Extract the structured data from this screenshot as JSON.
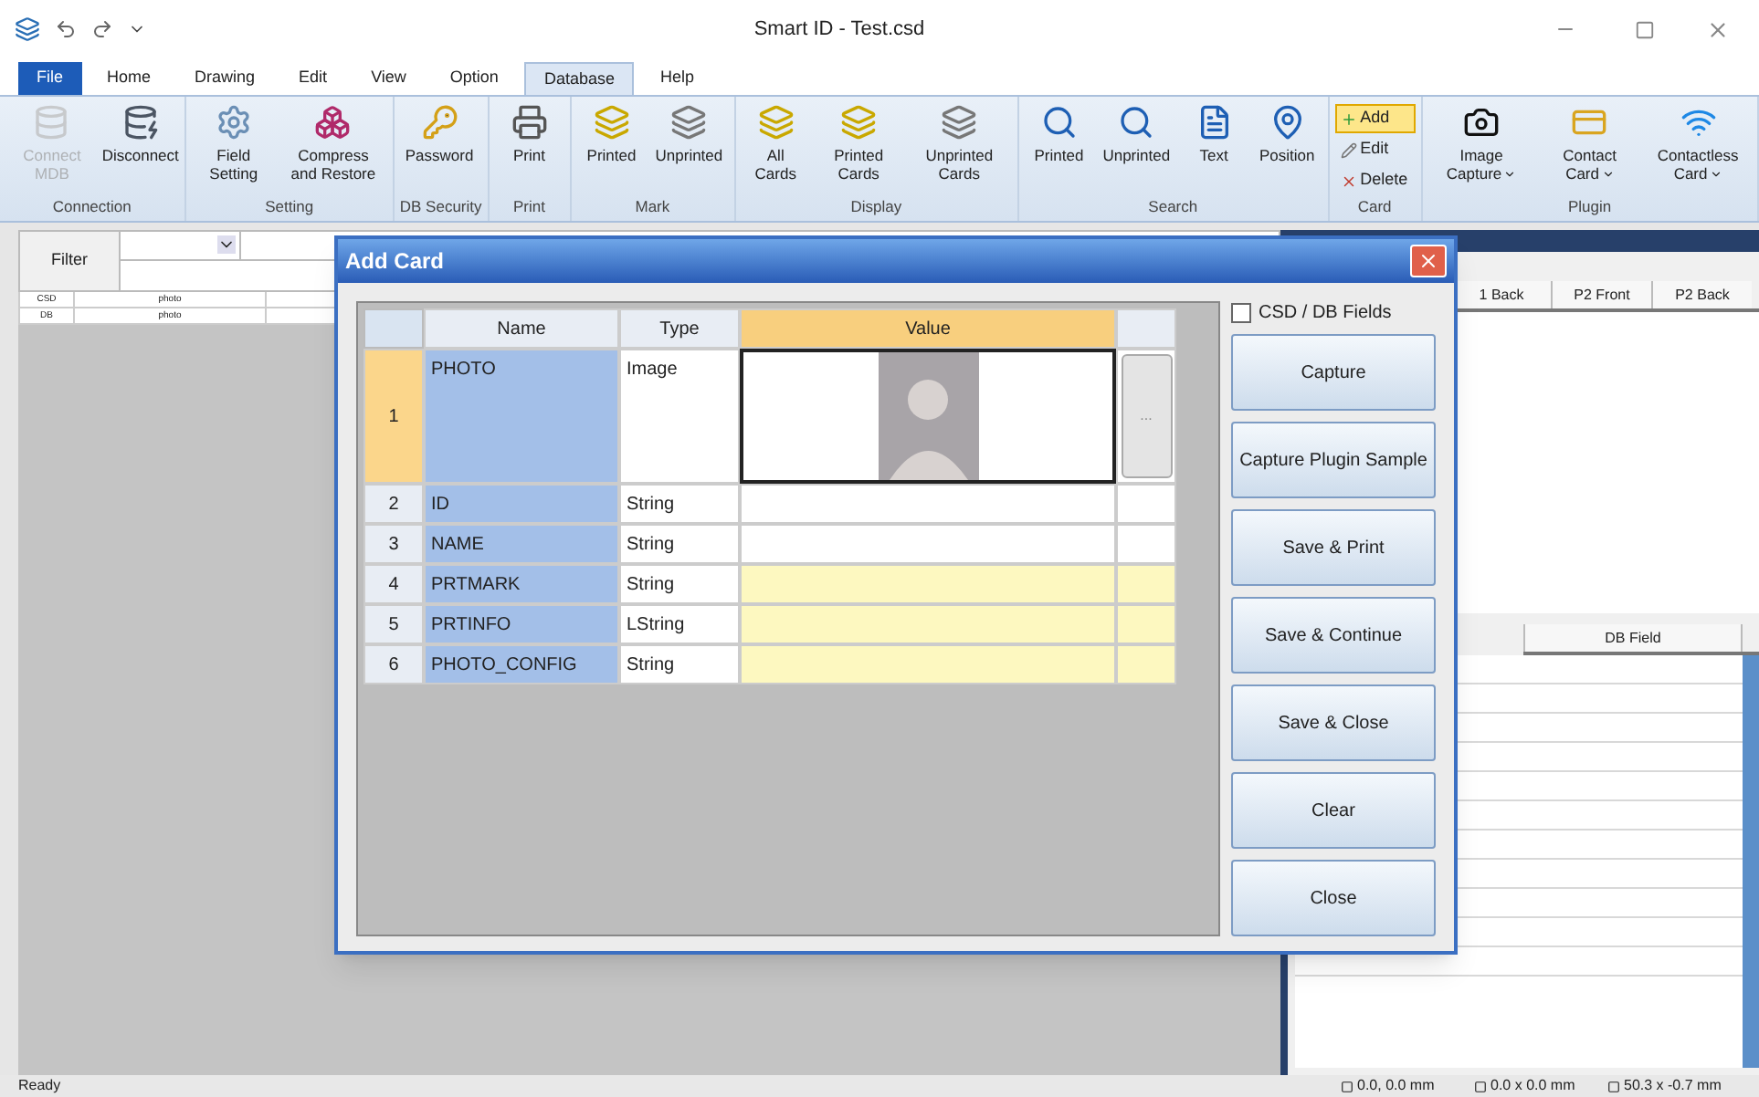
{
  "window": {
    "title": "Smart ID - Test.csd"
  },
  "tabs": [
    {
      "label": "File",
      "selected": false,
      "kind": "file"
    },
    {
      "label": "Home",
      "selected": false,
      "kind": "tab"
    },
    {
      "label": "Drawing",
      "selected": false,
      "kind": "tab"
    },
    {
      "label": "Edit",
      "selected": false,
      "kind": "tab"
    },
    {
      "label": "View",
      "selected": false,
      "kind": "tab"
    },
    {
      "label": "Option",
      "selected": false,
      "kind": "tab"
    },
    {
      "label": "Database",
      "selected": true,
      "kind": "tab"
    },
    {
      "label": "Help",
      "selected": false,
      "kind": "tab"
    }
  ],
  "ribbon": [
    {
      "label": "Connection",
      "items": [
        {
          "label": "Connect MDB",
          "kind": "large",
          "disabled": true
        },
        {
          "label": "Disconnect",
          "kind": "large",
          "disabled": false
        }
      ]
    },
    {
      "label": "Setting",
      "items": [
        {
          "label": "Field Setting",
          "kind": "large",
          "disabled": false
        },
        {
          "label": "Compress and Restore",
          "kind": "large",
          "disabled": false
        }
      ]
    },
    {
      "label": "DB Security",
      "items": [
        {
          "label": "Password",
          "kind": "large",
          "disabled": false
        }
      ]
    },
    {
      "label": "Print",
      "items": [
        {
          "label": "Print",
          "kind": "large",
          "disabled": false
        }
      ]
    },
    {
      "label": "Mark",
      "items": [
        {
          "label": "Printed",
          "kind": "large",
          "disabled": false
        },
        {
          "label": "Unprinted",
          "kind": "large",
          "disabled": false
        }
      ]
    },
    {
      "label": "Display",
      "items": [
        {
          "label": "All Cards",
          "kind": "large",
          "disabled": false
        },
        {
          "label": "Printed Cards",
          "kind": "large",
          "disabled": false
        },
        {
          "label": "Unprinted Cards",
          "kind": "large",
          "disabled": false
        }
      ]
    },
    {
      "label": "Search",
      "items": [
        {
          "label": "Printed",
          "kind": "large",
          "disabled": false
        },
        {
          "label": "Unprinted",
          "kind": "large",
          "disabled": false
        },
        {
          "label": "Text",
          "kind": "large",
          "disabled": false
        },
        {
          "label": "Position",
          "kind": "large",
          "disabled": false
        }
      ]
    },
    {
      "label": "Card",
      "items": [
        {
          "label": "Add",
          "kind": "small",
          "disabled": false,
          "selected": true
        },
        {
          "label": "Edit",
          "kind": "small",
          "disabled": false,
          "selected": false
        },
        {
          "label": "Delete",
          "kind": "small",
          "disabled": false,
          "selected": false
        }
      ]
    },
    {
      "label": "Plugin",
      "items": [
        {
          "label": "Image Capture",
          "kind": "menu",
          "disabled": false
        },
        {
          "label": "Contact Card",
          "kind": "menu",
          "disabled": false
        },
        {
          "label": "Contactless Card",
          "kind": "menu",
          "disabled": false
        }
      ]
    }
  ],
  "filter": {
    "label": "Filter"
  },
  "records": [
    {
      "source": "CSD",
      "field": "photo"
    },
    {
      "source": "DB",
      "field": "photo"
    }
  ],
  "preview_tabs": [
    "1 Back",
    "P2 Front",
    "P2 Back"
  ],
  "field_tabs": [
    "DB Field"
  ],
  "status_bar": {
    "text": "Ready",
    "position": "0.0, 0.0 mm",
    "size": "0.0 x 0.0 mm",
    "cursor": "50.3 x -0.7 mm"
  },
  "dialog": {
    "title": "Add Card",
    "columns": [
      {
        "label": "Name",
        "selected": false
      },
      {
        "label": "Type",
        "selected": false
      },
      {
        "label": "Value",
        "selected": true
      }
    ],
    "rows": [
      {
        "number": "1",
        "name": "PHOTO",
        "type": "Image",
        "kind": "image",
        "selected": true,
        "highlighted": false,
        "browse": "..."
      },
      {
        "number": "2",
        "name": "ID",
        "type": "String",
        "kind": "text",
        "selected": false,
        "highlighted": false
      },
      {
        "number": "3",
        "name": "NAME",
        "type": "String",
        "kind": "text",
        "selected": false,
        "highlighted": false
      },
      {
        "number": "4",
        "name": "PRTMARK",
        "type": "String",
        "kind": "text",
        "selected": false,
        "highlighted": true
      },
      {
        "number": "5",
        "name": "PRTINFO",
        "type": "LString",
        "kind": "text",
        "selected": false,
        "highlighted": true
      },
      {
        "number": "6",
        "name": "PHOTO_CONFIG",
        "type": "String",
        "kind": "text",
        "selected": false,
        "highlighted": true
      }
    ],
    "checkbox": {
      "label": "CSD / DB Fields",
      "checked": false
    },
    "buttons": [
      "Capture",
      "Capture Plugin Sample",
      "Save & Print",
      "Save & Continue",
      "Save & Close",
      "Clear",
      "Close"
    ]
  }
}
